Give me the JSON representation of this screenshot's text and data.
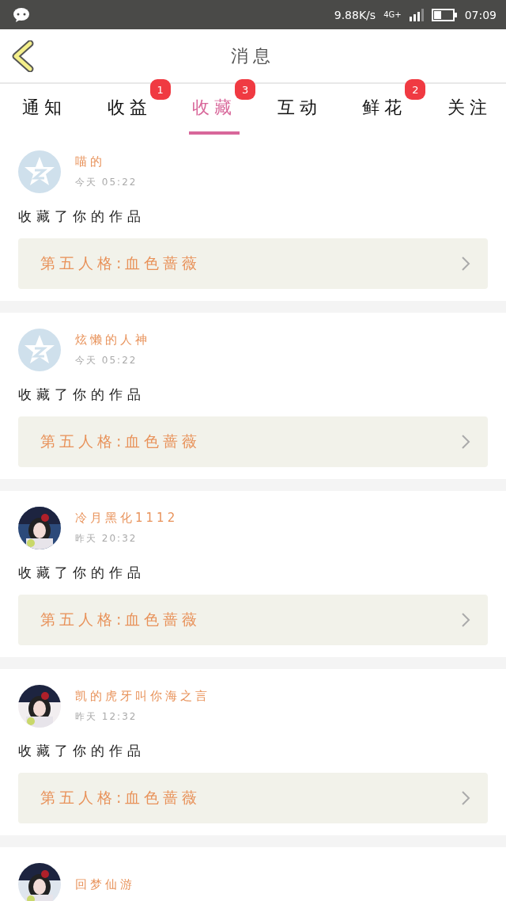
{
  "status_bar": {
    "speed": "9.88K/s",
    "network": "4G+",
    "time": "07:09"
  },
  "header": {
    "title": "消息"
  },
  "tabs": [
    {
      "label": "通知",
      "selected": false
    },
    {
      "label": "收益",
      "selected": false,
      "badge": "1"
    },
    {
      "label": "收藏",
      "selected": true,
      "badge": "3"
    },
    {
      "label": "互动",
      "selected": false
    },
    {
      "label": "鲜花",
      "selected": false,
      "badge": "2"
    },
    {
      "label": "关注",
      "selected": false
    }
  ],
  "messages": [
    {
      "avatar": {
        "kind": "default"
      },
      "name": "喵的",
      "time": "今天 05:22",
      "text": "收藏了你的作品",
      "work": "第五人格:血色蔷薇"
    },
    {
      "avatar": {
        "kind": "default"
      },
      "name": "炫懒的人神",
      "time": "今天 05:22",
      "text": "收藏了你的作品",
      "work": "第五人格:血色蔷薇"
    },
    {
      "name": "冷月黑化1112",
      "time": "昨天 20:32",
      "text": "收藏了你的作品",
      "work": "第五人格:血色蔷薇"
    },
    {
      "name": "凯的虎牙叫你海之言",
      "time": "昨天 12:32",
      "text": "收藏了你的作品",
      "work": "第五人格:血色蔷薇"
    },
    {
      "name": "回梦仙游"
    }
  ]
}
